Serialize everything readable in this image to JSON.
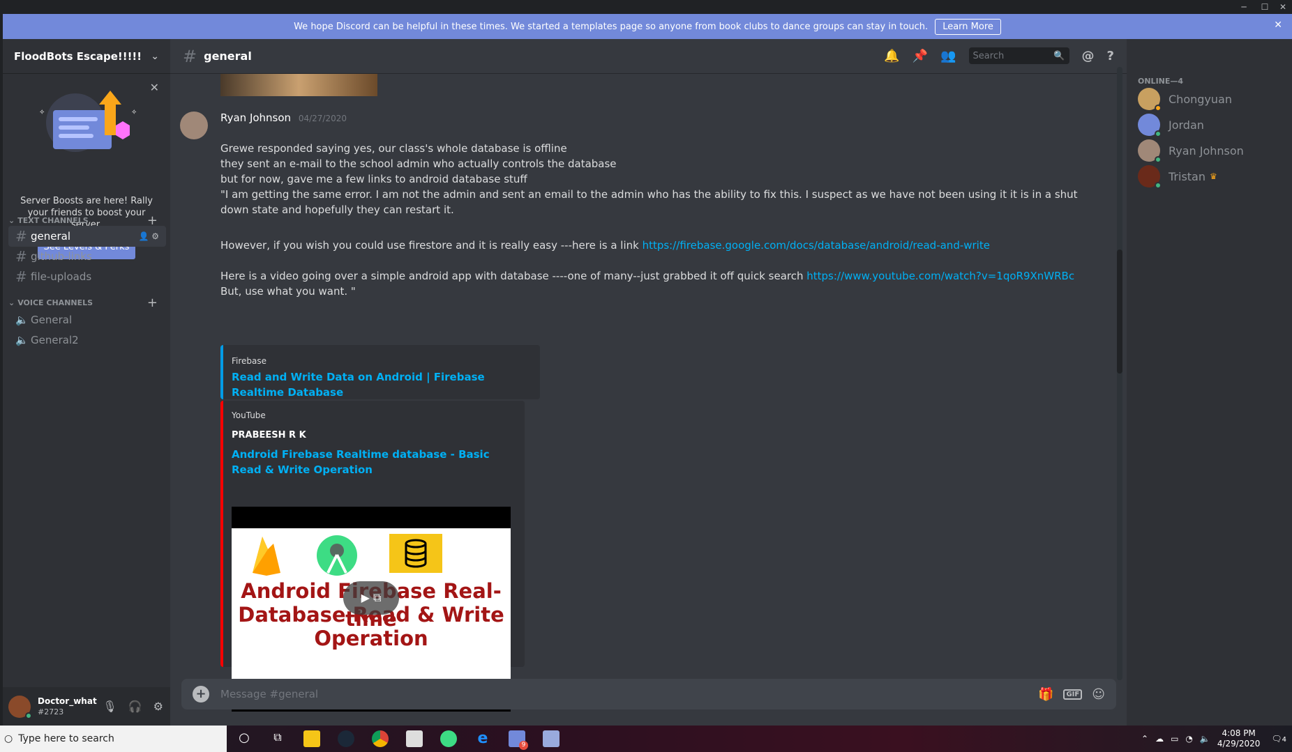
{
  "notice": {
    "text": "We hope Discord can be helpful in these times. We started a templates page so anyone from book clubs to dance groups can stay in touch.",
    "button": "Learn More"
  },
  "server": {
    "name": "FloodBots Escape!!!!!",
    "boost_message": "Server Boosts are here! Rally your friends to boost your server.",
    "boost_button": "See Levels & Perks"
  },
  "categories": {
    "text": "TEXT CHANNELS",
    "voice": "VOICE CHANNELS"
  },
  "text_channels": [
    {
      "name": "general"
    },
    {
      "name": "github-links"
    },
    {
      "name": "file-uploads"
    }
  ],
  "voice_channels": [
    {
      "name": "General"
    },
    {
      "name": "General2"
    }
  ],
  "user": {
    "name": "Doctor_what",
    "tag": "#2723"
  },
  "channel": {
    "name": "general",
    "search_placeholder": "Search"
  },
  "message": {
    "author": "Ryan Johnson",
    "timestamp": "04/27/2020",
    "lines": [
      "Grewe responded saying yes, our class's whole database is offline",
      "they sent an e-mail to the school admin who actually controls the database",
      "but for now, gave me a few links to android database stuff",
      "\"I am getting the same error.    I am not the admin and sent an email to the admin who has the ability to fix this.   I suspect as we have not been using it it is in a shut down state and hopefully they can restart it."
    ],
    "firestore_text": "However, if you wish you could use firestore and it is really easy ---here is a link ",
    "firestore_link": "https://firebase.google.com/docs/database/android/read-and-write",
    "video_text": "Here is a video going over a simple android app with database ----one of many--just grabbed it off quick search ",
    "video_link": "https://www.youtube.com/watch?v=1qoR9XnWRBc",
    "closing": "But, use what you want. \""
  },
  "embeds": {
    "firebase": {
      "provider": "Firebase",
      "title": "Read and Write Data on Android  |  Firebase Realtime Database"
    },
    "youtube": {
      "provider": "YouTube",
      "author": "PRABEESH R K",
      "title": "Android Firebase Realtime database - Basic Read & Write Operation",
      "thumb_line1": "Android Firebase Real-time",
      "thumb_line2": "Database Read & Write",
      "thumb_line3": "Operation"
    }
  },
  "composer": {
    "placeholder": "Message #general"
  },
  "members": {
    "heading": "ONLINE—4",
    "list": [
      {
        "name": "Chongyuan",
        "color": "#c8a060"
      },
      {
        "name": "Jordan",
        "color": "#7289da"
      },
      {
        "name": "Ryan Johnson",
        "color": "#a08878"
      },
      {
        "name": "Tristan",
        "color": "#6a2a1a"
      }
    ]
  },
  "taskbar": {
    "search_placeholder": "Type here to search",
    "time": "4:08 PM",
    "date": "4/29/2020",
    "notification_count": "4",
    "discord_badge": "9"
  },
  "colors": {
    "accent": "#7289da",
    "online": "#43b581",
    "link": "#00b0f4",
    "youtube": "#ff0000",
    "firebase": "#039be5"
  }
}
